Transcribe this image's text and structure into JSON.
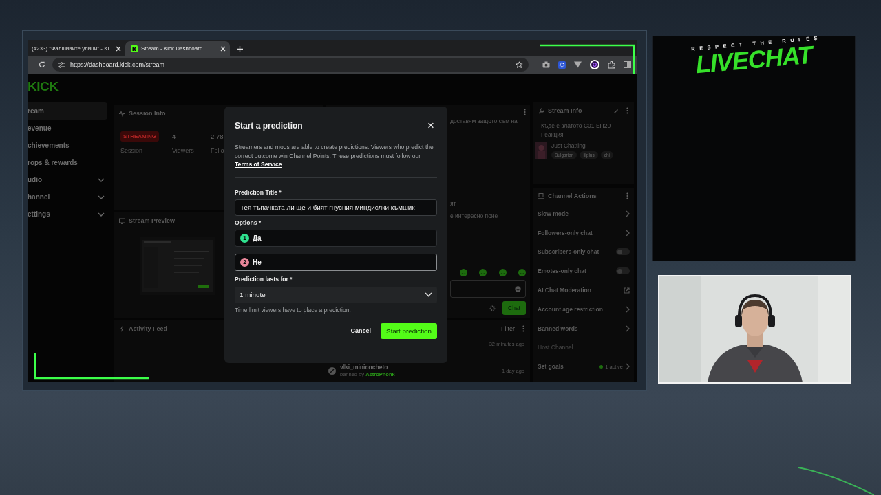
{
  "browser": {
    "tabs": [
      {
        "title": "(4233) \"Фалшивите улици\" - Ki",
        "selected": false
      },
      {
        "title": "Stream - Kick Dashboard",
        "selected": true
      }
    ],
    "url": "https://dashboard.kick.com/stream"
  },
  "dashboard": {
    "logo": "KICK",
    "sidebar": [
      {
        "label": "ream",
        "selected": true,
        "expandable": false
      },
      {
        "label": "evenue",
        "selected": false,
        "expandable": false
      },
      {
        "label": "chievements",
        "selected": false,
        "expandable": false
      },
      {
        "label": "rops & rewards",
        "selected": false,
        "expandable": false
      },
      {
        "label": "udio",
        "selected": false,
        "expandable": true
      },
      {
        "label": "hannel",
        "selected": false,
        "expandable": true
      },
      {
        "label": "ettings",
        "selected": false,
        "expandable": true
      }
    ],
    "session_info": {
      "title": "Session Info",
      "badge": "STREAMING",
      "badge_label": "Session",
      "stats": [
        {
          "value": "4",
          "label": "Viewers"
        },
        {
          "value": "2,78",
          "label": "Follo"
        }
      ]
    },
    "stream_preview": {
      "title": "Stream Preview"
    },
    "chat": {
      "lines": [
        {
          "text": "доставям защото съм на"
        },
        {
          "text": "ят"
        },
        {
          "text": "е интересно поне"
        }
      ],
      "send": "Chat"
    },
    "activity_feed": {
      "title": "Activity Feed",
      "filter": "Filter",
      "events": [
        {
          "time": "32 minutes ago"
        },
        {
          "user": "vlki_minioncheto",
          "detail": "banned by ",
          "actor": "AstroPhonk",
          "time": "1 day ago"
        }
      ]
    },
    "stream_info": {
      "title": "Stream Info",
      "stream_title": "Къде е златото С01 ЕП20 Реакция",
      "category": "Just Chatting",
      "tags": [
        "Bulgarian",
        "lilplus",
        "chi"
      ]
    },
    "channel_actions": {
      "title": "Channel Actions",
      "items": [
        {
          "label": "Slow mode",
          "kind": "arrow"
        },
        {
          "label": "Followers-only chat",
          "kind": "arrow"
        },
        {
          "label": "Subscribers-only chat",
          "kind": "toggle",
          "on": false
        },
        {
          "label": "Emotes-only chat",
          "kind": "toggle",
          "on": false
        },
        {
          "label": "AI Chat Moderation",
          "kind": "external"
        },
        {
          "label": "Account age restriction",
          "kind": "arrow"
        },
        {
          "label": "Banned words",
          "kind": "arrow"
        },
        {
          "label": "Host Channel",
          "kind": "disabled"
        },
        {
          "label": "Set goals",
          "kind": "goals",
          "badge": "1 active"
        }
      ]
    }
  },
  "modal": {
    "title": "Start a prediction",
    "close": "×",
    "description": "Streamers and mods are able to create predictions. Viewers who predict the correct outcome win Channel Points. These predictions must follow our ",
    "link": "Terms of Service",
    "description_end": ".",
    "title_label": "Prediction Title *",
    "title_value": "Тея тъпачката ли ще и бият гнусния миндислки къмшик",
    "options_label": "Options *",
    "options": [
      {
        "number": "1",
        "value": "Да",
        "color": "#2fe08e",
        "focused": false
      },
      {
        "number": "2",
        "value": "Не",
        "color": "#e8879a",
        "focused": true
      }
    ],
    "duration_label": "Prediction lasts for *",
    "duration": "1 minute",
    "duration_hint": "Time limit viewers have to place a prediction.",
    "cancel": "Cancel",
    "submit": "Start prediction"
  },
  "overlay": {
    "tagline": "RESPECT THE RULES",
    "title": "LIVECHAT"
  }
}
